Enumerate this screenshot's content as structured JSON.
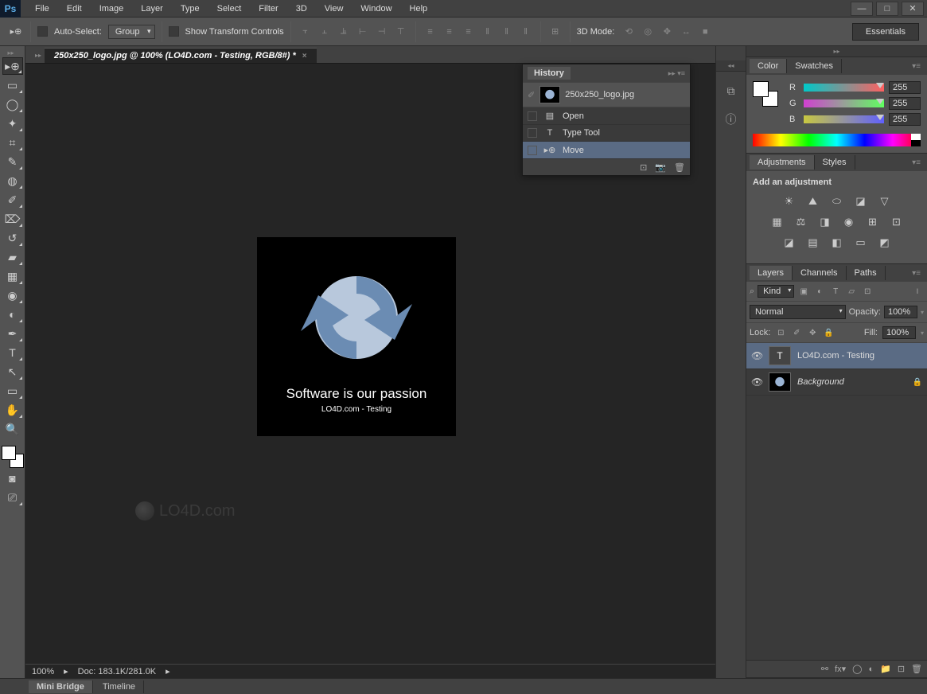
{
  "app": {
    "logo": "Ps"
  },
  "menus": [
    "File",
    "Edit",
    "Image",
    "Layer",
    "Type",
    "Select",
    "Filter",
    "3D",
    "View",
    "Window",
    "Help"
  ],
  "options_bar": {
    "auto_select": "Auto-Select:",
    "group": "Group",
    "show_transform": "Show Transform Controls",
    "mode_3d": "3D Mode:",
    "essentials": "Essentials"
  },
  "doc_tab": "250x250_logo.jpg @ 100% (LO4D.com - Testing, RGB/8#) *",
  "canvas": {
    "tagline": "Software is our passion",
    "subline": "LO4D.com - Testing"
  },
  "watermark": "LO4D.com",
  "status": {
    "zoom": "100%",
    "doc_info": "Doc: 183.1K/281.0K"
  },
  "bottom_tabs": [
    "Mini Bridge",
    "Timeline"
  ],
  "history": {
    "title": "History",
    "doc": "250x250_logo.jpg",
    "steps": [
      "Open",
      "Type Tool",
      "Move"
    ]
  },
  "color_panel": {
    "tabs": [
      "Color",
      "Swatches"
    ],
    "r_label": "R",
    "g_label": "G",
    "b_label": "B",
    "r": "255",
    "g": "255",
    "b": "255"
  },
  "adjustments": {
    "tabs": [
      "Adjustments",
      "Styles"
    ],
    "label": "Add an adjustment"
  },
  "layers": {
    "tabs": [
      "Layers",
      "Channels",
      "Paths"
    ],
    "kind": "Kind",
    "blend": "Normal",
    "opacity_label": "Opacity:",
    "opacity": "100%",
    "lock_label": "Lock:",
    "fill_label": "Fill:",
    "fill": "100%",
    "items": [
      {
        "name": "LO4D.com - Testing",
        "type": "text",
        "visible": true,
        "locked": false
      },
      {
        "name": "Background",
        "type": "image",
        "visible": true,
        "locked": true
      }
    ]
  }
}
